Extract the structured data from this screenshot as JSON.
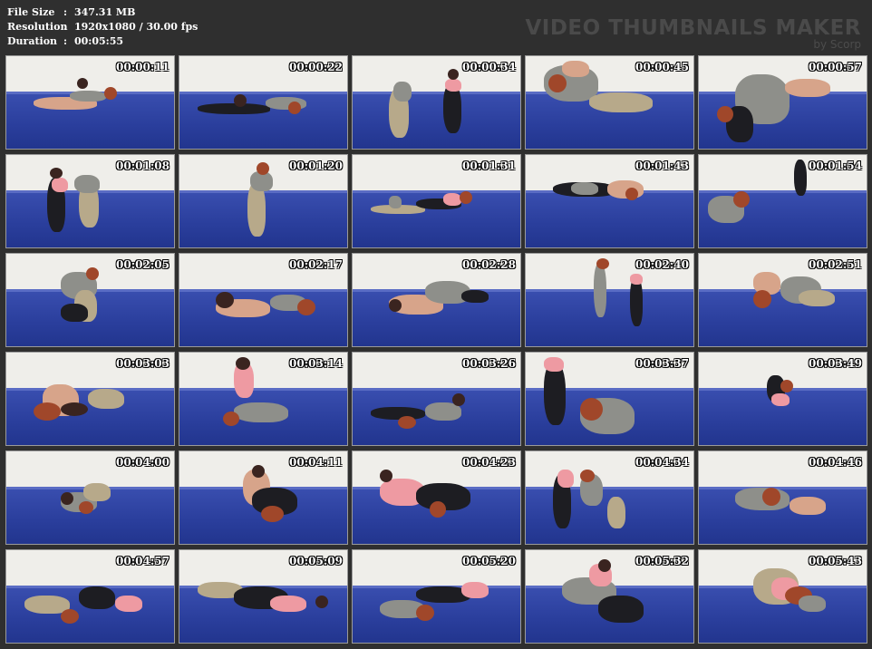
{
  "header": {
    "file_size_label": "File Size",
    "file_size_value": "347.31 MB",
    "resolution_label": "Resolution",
    "resolution_value": "1920x1080 / 30.00 fps",
    "duration_label": "Duration",
    "duration_value": "00:05:55",
    "separator": ":"
  },
  "watermark": {
    "title": "VIDEO THUMBNAILS MAKER",
    "subtitle": "by Scorp"
  },
  "thumbnails": [
    {
      "time": "00:00:11"
    },
    {
      "time": "00:00:22"
    },
    {
      "time": "00:00:34"
    },
    {
      "time": "00:00:45"
    },
    {
      "time": "00:00:57"
    },
    {
      "time": "00:01:08"
    },
    {
      "time": "00:01:20"
    },
    {
      "time": "00:01:31"
    },
    {
      "time": "00:01:43"
    },
    {
      "time": "00:01:54"
    },
    {
      "time": "00:02:05"
    },
    {
      "time": "00:02:17"
    },
    {
      "time": "00:02:28"
    },
    {
      "time": "00:02:40"
    },
    {
      "time": "00:02:51"
    },
    {
      "time": "00:03:03"
    },
    {
      "time": "00:03:14"
    },
    {
      "time": "00:03:26"
    },
    {
      "time": "00:03:37"
    },
    {
      "time": "00:03:49"
    },
    {
      "time": "00:04:00"
    },
    {
      "time": "00:04:11"
    },
    {
      "time": "00:04:23"
    },
    {
      "time": "00:04:34"
    },
    {
      "time": "00:04:46"
    },
    {
      "time": "00:04:57"
    },
    {
      "time": "00:05:09"
    },
    {
      "time": "00:05:20"
    },
    {
      "time": "00:05:32"
    },
    {
      "time": "00:05:43"
    }
  ]
}
